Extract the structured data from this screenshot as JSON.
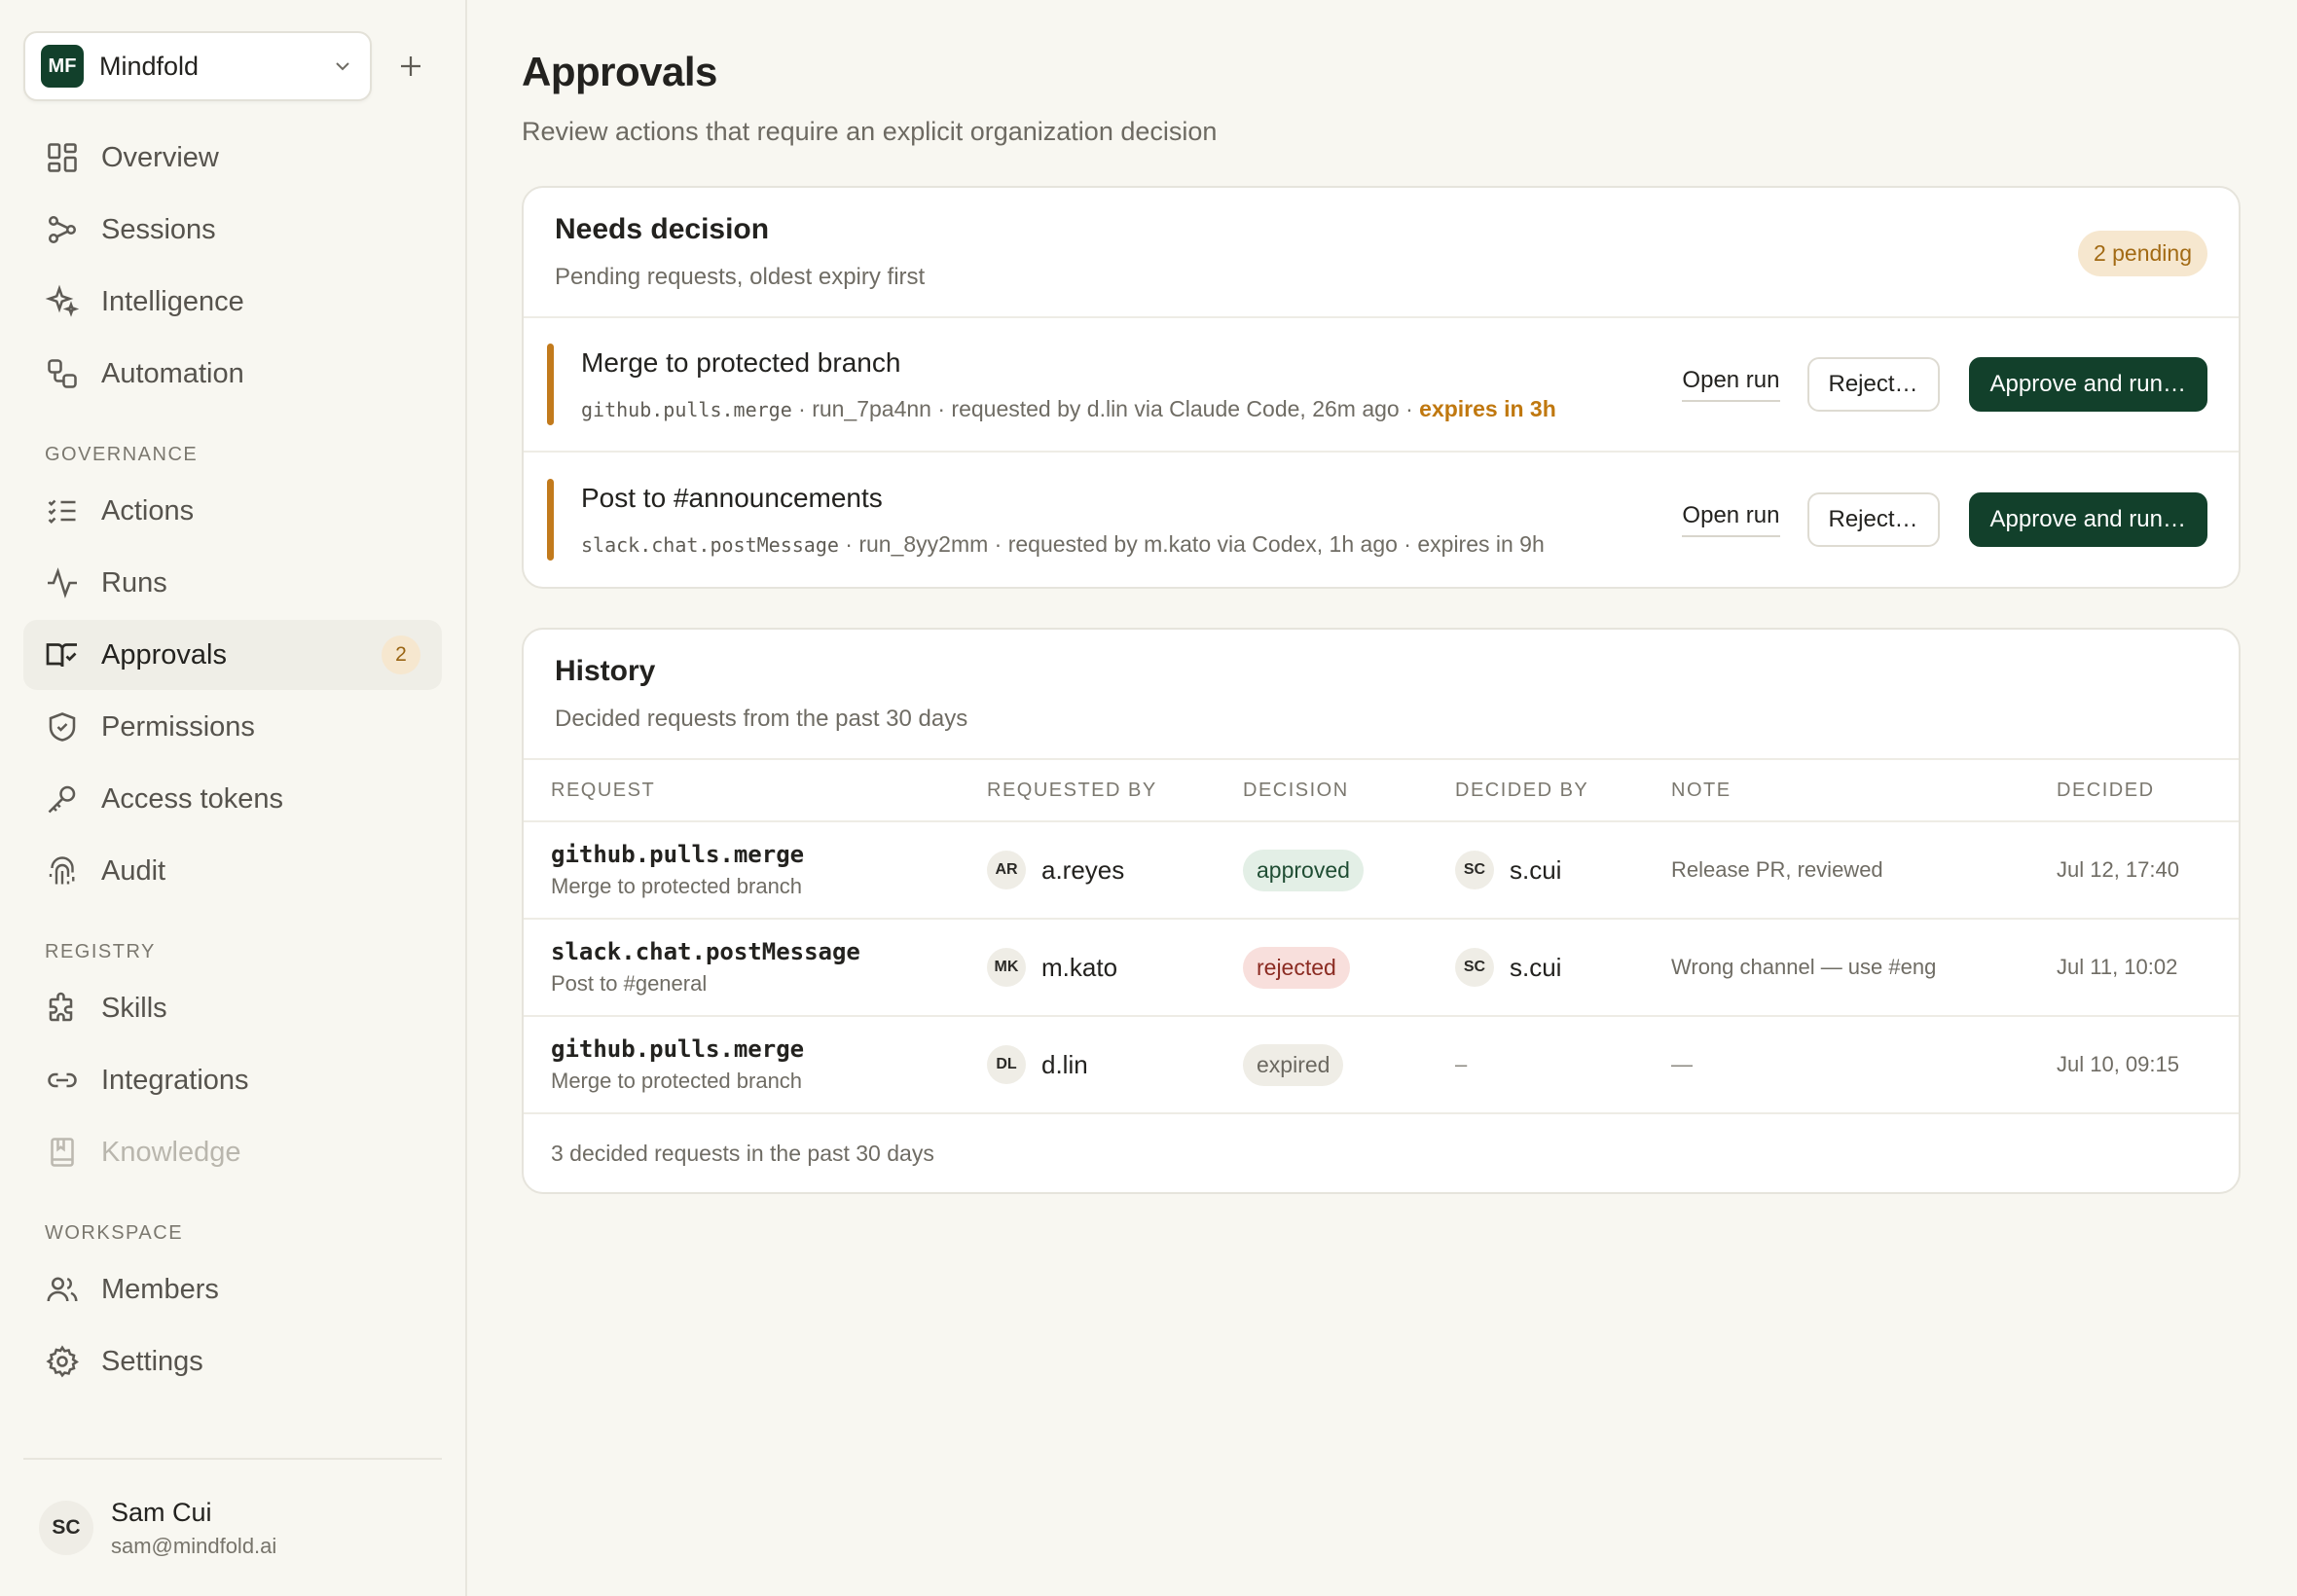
{
  "org": {
    "initials": "MF",
    "name": "Mindfold"
  },
  "nav": {
    "main": [
      {
        "label": "Overview",
        "icon": "overview-icon"
      },
      {
        "label": "Sessions",
        "icon": "sessions-icon"
      },
      {
        "label": "Intelligence",
        "icon": "sparkle-icon"
      },
      {
        "label": "Automation",
        "icon": "automation-icon"
      }
    ],
    "governance_label": "GOVERNANCE",
    "governance": [
      {
        "label": "Actions",
        "icon": "checklist-icon"
      },
      {
        "label": "Runs",
        "icon": "pulse-icon"
      },
      {
        "label": "Approvals",
        "icon": "approvals-icon",
        "badge": "2",
        "active": true
      },
      {
        "label": "Permissions",
        "icon": "shield-icon"
      },
      {
        "label": "Access tokens",
        "icon": "key-icon"
      },
      {
        "label": "Audit",
        "icon": "fingerprint-icon"
      }
    ],
    "registry_label": "REGISTRY",
    "registry": [
      {
        "label": "Skills",
        "icon": "puzzle-icon"
      },
      {
        "label": "Integrations",
        "icon": "link-icon"
      },
      {
        "label": "Knowledge",
        "icon": "book-icon",
        "disabled": true
      }
    ],
    "workspace_label": "WORKSPACE",
    "workspace": [
      {
        "label": "Members",
        "icon": "members-icon"
      },
      {
        "label": "Settings",
        "icon": "gear-icon"
      }
    ]
  },
  "user": {
    "initials": "SC",
    "name": "Sam Cui",
    "email": "sam@mindfold.ai"
  },
  "page": {
    "title": "Approvals",
    "subtitle": "Review actions that require an explicit organization decision"
  },
  "needs_decision": {
    "title": "Needs decision",
    "subtitle": "Pending requests, oldest expiry first",
    "pending_badge": "2 pending",
    "requests": [
      {
        "title": "Merge to protected branch",
        "action": "github.pulls.merge",
        "meta": " · run_7pa4nn · requested by d.lin via Claude Code, 26m ago · ",
        "expires": "expires in 3h",
        "open_label": "Open run",
        "reject_label": "Reject…",
        "approve_label": "Approve and run…"
      },
      {
        "title": "Post to #announcements",
        "action": "slack.chat.postMessage",
        "meta": " · run_8yy2mm · requested by m.kato via Codex, 1h ago · ",
        "expires": "expires in 9h",
        "open_label": "Open run",
        "reject_label": "Reject…",
        "approve_label": "Approve and run…"
      }
    ]
  },
  "history": {
    "title": "History",
    "subtitle": "Decided requests from the past 30 days",
    "columns": [
      "REQUEST",
      "REQUESTED BY",
      "DECISION",
      "DECIDED BY",
      "NOTE",
      "DECIDED"
    ],
    "rows": [
      {
        "code": "github.pulls.merge",
        "desc": "Merge to protected branch",
        "req_initials": "AR",
        "req_by": "a.reyes",
        "decision": "approved",
        "dec_initials": "SC",
        "dec_by": "s.cui",
        "note": "Release PR, reviewed",
        "date": "Jul 12, 17:40"
      },
      {
        "code": "slack.chat.postMessage",
        "desc": "Post to #general",
        "req_initials": "MK",
        "req_by": "m.kato",
        "decision": "rejected",
        "dec_initials": "SC",
        "dec_by": "s.cui",
        "note": "Wrong channel — use #eng",
        "date": "Jul 11, 10:02"
      },
      {
        "code": "github.pulls.merge",
        "desc": "Merge to protected branch",
        "req_initials": "DL",
        "req_by": "d.lin",
        "decision": "expired",
        "dec_by": "–",
        "note": "—",
        "date": "Jul 10, 09:15"
      }
    ],
    "footer": "3 decided requests in the past 30 days"
  },
  "colors": {
    "accent_dark_green": "#12402b",
    "pending_amber": "#c27a1c",
    "approved_bg": "#e3efe6",
    "rejected_bg": "#f8dfdc",
    "expired_bg": "#efede6"
  }
}
